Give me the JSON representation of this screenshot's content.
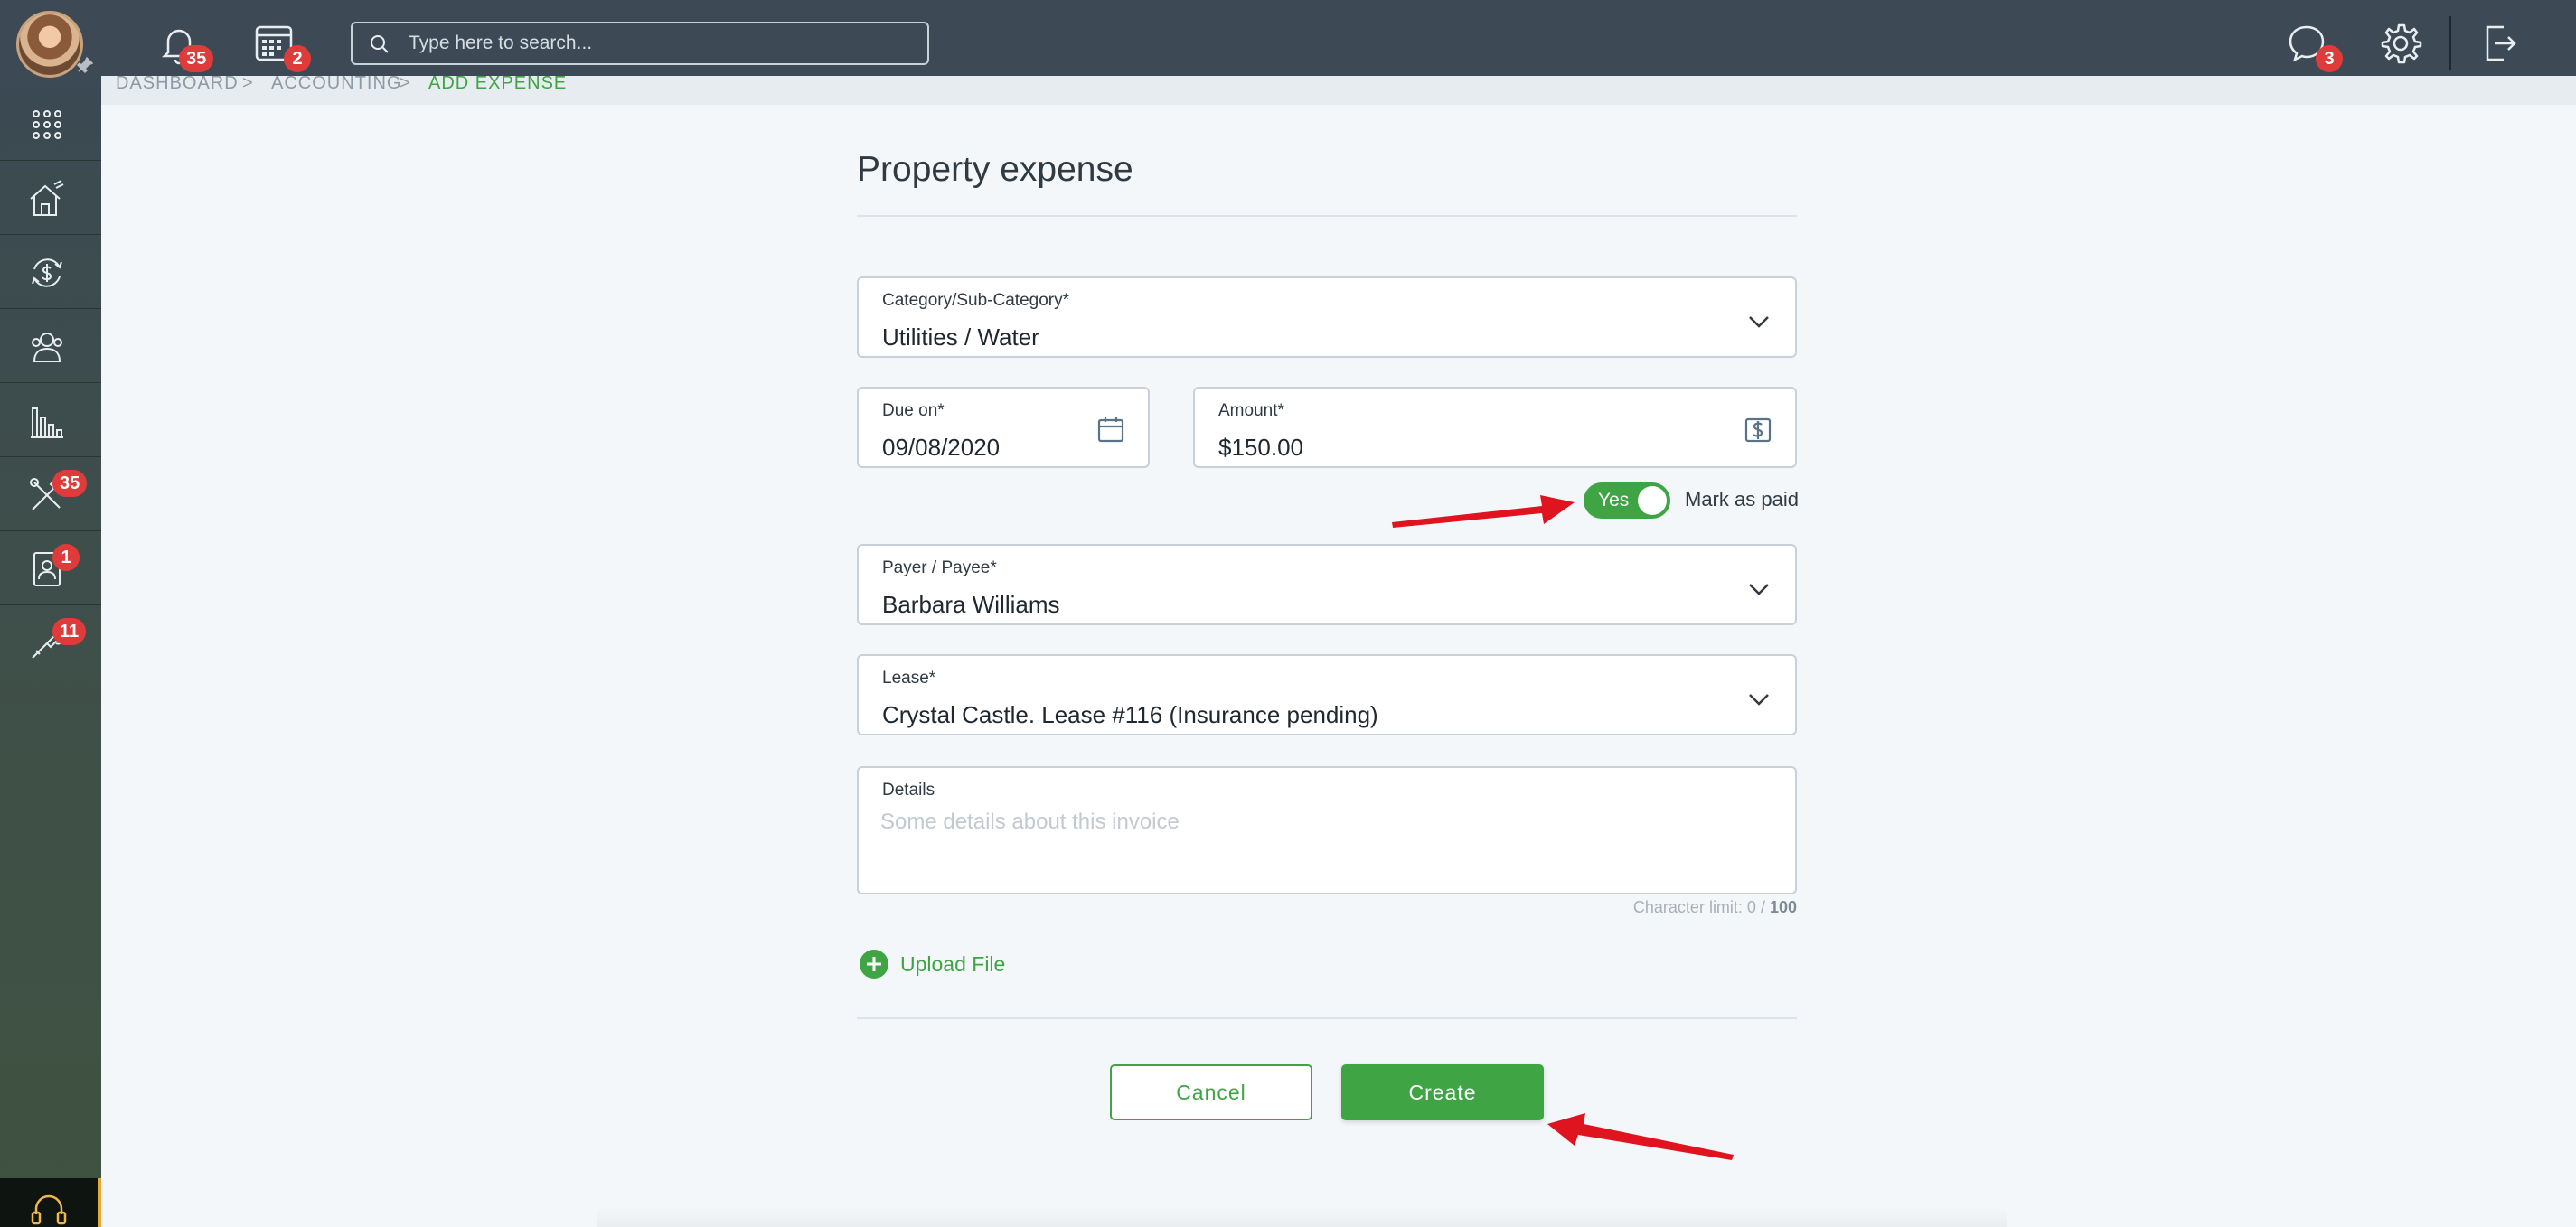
{
  "topbar": {
    "notifications_count": "35",
    "calendar_count": "2",
    "search_placeholder": "Type here to search...",
    "messages_count": "3"
  },
  "sidebar": {
    "items": [
      {
        "icon": "apps-grid-icon",
        "badge": ""
      },
      {
        "icon": "property-house-icon",
        "badge": ""
      },
      {
        "icon": "accounting-cycle-icon",
        "badge": ""
      },
      {
        "icon": "people-icon",
        "badge": ""
      },
      {
        "icon": "reports-chart-icon",
        "badge": ""
      },
      {
        "icon": "maintenance-tools-icon",
        "badge": "35"
      },
      {
        "icon": "contacts-icon",
        "badge": "1"
      },
      {
        "icon": "tools-wrench-icon",
        "badge": "11"
      }
    ]
  },
  "breadcrumb": {
    "items": [
      "DASHBOARD",
      "ACCOUNTING",
      "ADD EXPENSE"
    ],
    "separator": ">"
  },
  "form": {
    "title": "Property expense",
    "category": {
      "label": "Category/Sub-Category*",
      "value": "Utilities / Water"
    },
    "due_on": {
      "label": "Due on*",
      "value": "09/08/2020"
    },
    "amount": {
      "label": "Amount*",
      "value": "$150.00"
    },
    "mark_paid": {
      "toggle_text": "Yes",
      "label": "Mark as paid",
      "on": true
    },
    "payer": {
      "label": "Payer / Payee*",
      "value": "Barbara Williams"
    },
    "lease": {
      "label": "Lease*",
      "value": "Crystal Castle. Lease #116 (Insurance pending)"
    },
    "details": {
      "label": "Details",
      "placeholder": "Some details about this invoice"
    },
    "char_limit": {
      "text": "Character limit: 0 / ",
      "max": "100"
    },
    "upload_label": "Upload File",
    "cancel_label": "Cancel",
    "create_label": "Create"
  },
  "colors": {
    "accent": "#3ea444",
    "topbar": "#3d4a56",
    "badge": "#e03b3b",
    "annotation_arrow": "#e0141e"
  }
}
